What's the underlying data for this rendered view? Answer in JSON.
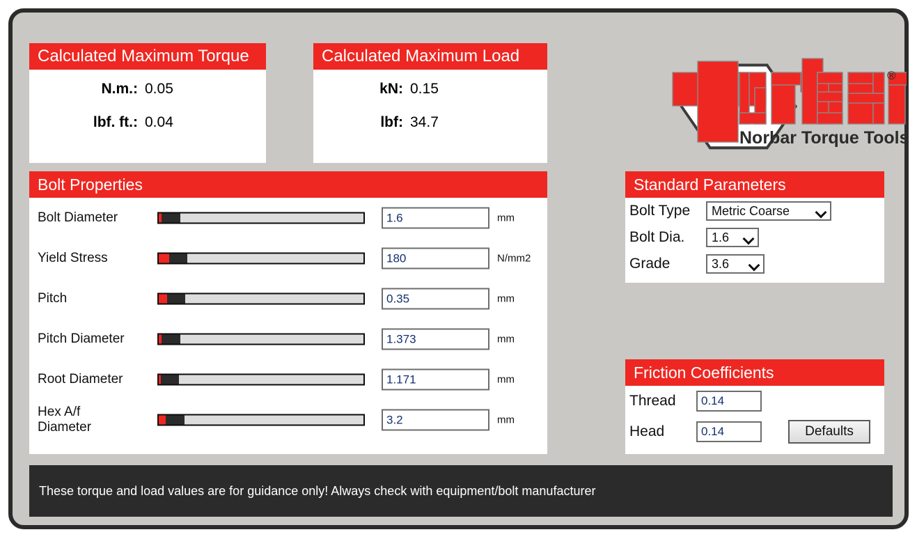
{
  "cards": {
    "torque": {
      "title": "Calculated Maximum Torque",
      "rows": [
        {
          "label": "N.m.:",
          "value": "0.05"
        },
        {
          "label": "lbf. ft.:",
          "value": "0.04"
        }
      ]
    },
    "load": {
      "title": "Calculated Maximum Load",
      "rows": [
        {
          "label": "kN:",
          "value": "0.15"
        },
        {
          "label": "lbf:",
          "value": "34.7"
        }
      ]
    }
  },
  "logo": {
    "wordmark": "norbar",
    "tagline": "Norbar Torque Tools",
    "registered": "®"
  },
  "bolt_properties": {
    "title": "Bolt Properties",
    "rows": [
      {
        "label": "Bolt Diameter",
        "value": "1.6",
        "unit": "mm",
        "fill_pct": 1.5,
        "thumb_pct": 9
      },
      {
        "label": "Yield Stress",
        "value": "180",
        "unit": "N/mm2",
        "fill_pct": 5,
        "thumb_pct": 9
      },
      {
        "label": "Pitch",
        "value": "0.35",
        "unit": "mm",
        "fill_pct": 4,
        "thumb_pct": 9
      },
      {
        "label": "Pitch Diameter",
        "value": "1.373",
        "unit": "mm",
        "fill_pct": 1.5,
        "thumb_pct": 9
      },
      {
        "label": "Root Diameter",
        "value": "1.171",
        "unit": "mm",
        "fill_pct": 1,
        "thumb_pct": 9
      },
      {
        "label": "Hex A/f Diameter",
        "value": "3.2",
        "unit": "mm",
        "fill_pct": 3.5,
        "thumb_pct": 9
      }
    ]
  },
  "standard_parameters": {
    "title": "Standard Parameters",
    "bolt_type": {
      "label": "Bolt Type",
      "value": "Metric Coarse"
    },
    "bolt_dia": {
      "label": "Bolt Dia.",
      "value": "1.6"
    },
    "grade": {
      "label": "Grade",
      "value": "3.6"
    }
  },
  "friction": {
    "title": "Friction Coefficients",
    "thread": {
      "label": "Thread",
      "value": "0.14"
    },
    "head": {
      "label": "Head",
      "value": "0.14"
    },
    "defaults_label": "Defaults"
  },
  "footer": {
    "text": "These torque and load values are for guidance only! Always check with equipment/bolt manufacturer"
  },
  "colors": {
    "accent_red": "#ee2722",
    "panel_bg": "#ffffff",
    "app_bg": "#c9c8c4",
    "dark": "#2b2b2b"
  }
}
